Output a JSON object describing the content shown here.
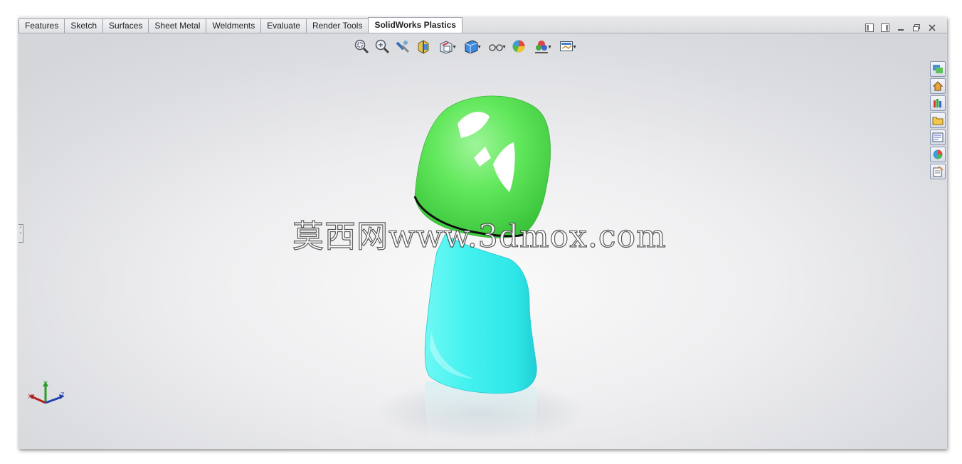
{
  "tabs": [
    {
      "label": "Features"
    },
    {
      "label": "Sketch"
    },
    {
      "label": "Surfaces"
    },
    {
      "label": "Sheet Metal"
    },
    {
      "label": "Weldments"
    },
    {
      "label": "Evaluate"
    },
    {
      "label": "Render Tools"
    },
    {
      "label": "SolidWorks Plastics",
      "active": true
    }
  ],
  "heads_up_toolbar": [
    {
      "icon": "zoom-to-fit-icon"
    },
    {
      "icon": "zoom-to-area-icon"
    },
    {
      "icon": "previous-view-icon"
    },
    {
      "icon": "section-view-icon"
    },
    {
      "icon": "view-orientation-icon"
    },
    {
      "icon": "display-style-icon"
    },
    {
      "icon": "hide-show-items-icon"
    },
    {
      "icon": "edit-appearance-icon"
    },
    {
      "icon": "apply-scene-icon"
    },
    {
      "icon": "view-settings-icon"
    }
  ],
  "window_controls": [
    "tile-horizontal-icon",
    "tile-vertical-icon",
    "minimize-icon",
    "restore-icon",
    "close-icon"
  ],
  "task_pane": [
    {
      "icon": "solidworks-resources-icon"
    },
    {
      "icon": "home-icon"
    },
    {
      "icon": "design-library-icon"
    },
    {
      "icon": "file-explorer-icon"
    },
    {
      "icon": "view-palette-icon"
    },
    {
      "icon": "appearances-scenes-icon"
    },
    {
      "icon": "custom-properties-icon"
    }
  ],
  "watermark": "莫西网www.3dmox.com",
  "triad": {
    "x": "X",
    "y": "Y",
    "z": "Z"
  },
  "colors": {
    "cap": "#5fe85a",
    "body": "#3ff0ee",
    "tab_border": "#9ea2aa",
    "viewport_bg": "#eeeef0"
  }
}
